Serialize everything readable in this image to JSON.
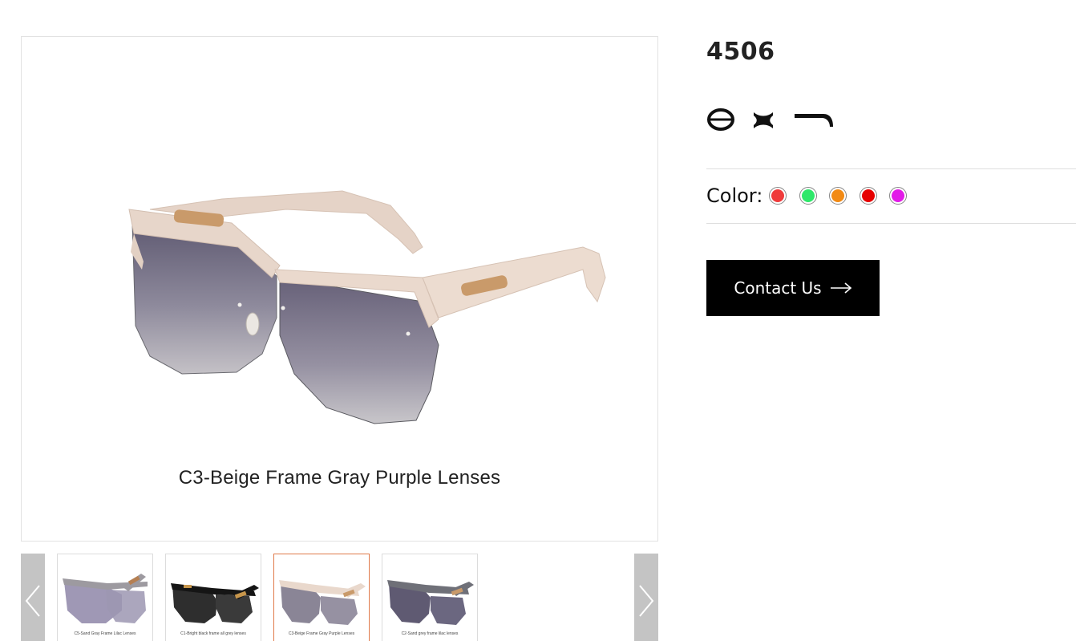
{
  "product": {
    "model": "4506",
    "main_caption": "C3-Beige Frame Gray Purple Lenses",
    "spec_icons": [
      "full-rim-lens-icon",
      "bridge-icon",
      "temple-arm-icon"
    ]
  },
  "color": {
    "label": "Color:",
    "swatches": [
      "#ef3b3b",
      "#2ee86a",
      "#f28a14",
      "#e60000",
      "#e21be8"
    ]
  },
  "thumbnails": [
    {
      "caption": "C5-Sand Gray Frame Lilac Lenses",
      "frame": "#9d9aa0",
      "lens": "#8e86a8"
    },
    {
      "caption": "C1-Bright black frame all grey lenses",
      "frame": "#151515",
      "lens": "#3a3a3a"
    },
    {
      "caption": "C3-Beige Frame Gray Purple Lenses",
      "frame": "#e9d8cc",
      "lens": "#8a8596"
    },
    {
      "caption": "C2-Sand grey frame lilac lenses",
      "frame": "#6f7078",
      "lens": "#6b6780"
    }
  ],
  "contact_button": {
    "label": "Contact Us"
  },
  "colors": {
    "accent": "#000000",
    "active_thumb_border": "#e07a4a",
    "nav_arrow_bg": "#c4c4c4"
  }
}
